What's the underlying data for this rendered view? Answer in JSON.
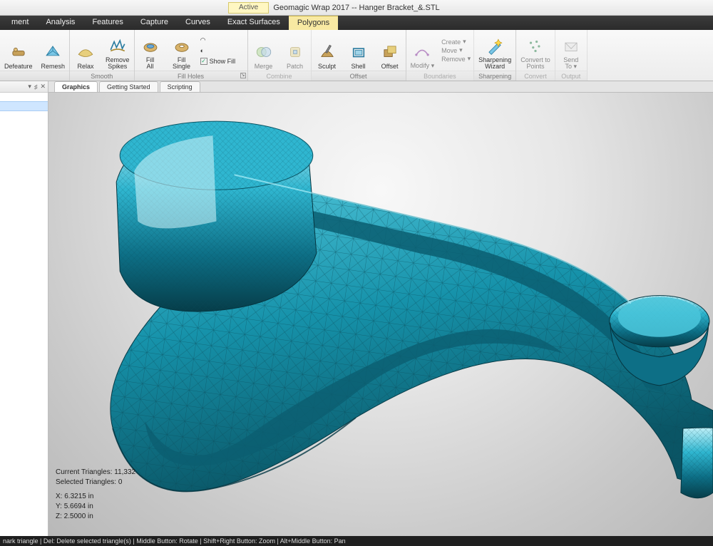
{
  "title": "Geomagic Wrap 2017 -- Hanger Bracket_&.STL",
  "active_badge": "Active",
  "menu": [
    "ment",
    "Analysis",
    "Features",
    "Capture",
    "Curves",
    "Exact Surfaces",
    "Polygons"
  ],
  "menu_active_index": 6,
  "ribbon": {
    "group0": {
      "label": "",
      "btns": [
        "Defeature",
        "Remesh"
      ]
    },
    "group1": {
      "label": "Smooth",
      "btns": [
        "Relax",
        "Remove Spikes"
      ]
    },
    "group2": {
      "label": "Fill Holes",
      "btns": [
        "Fill All",
        "Fill Single"
      ],
      "show_fill_check": "Show Fill"
    },
    "group3": {
      "label": "Combine",
      "btns": [
        "Merge",
        "Patch"
      ]
    },
    "group4": {
      "label": "Offset",
      "btns": [
        "Sculpt",
        "Shell",
        "Offset"
      ]
    },
    "group5": {
      "label": "Boundaries",
      "btn": "Modify",
      "lines": [
        "Create",
        "Move",
        "Remove"
      ]
    },
    "group6": {
      "label": "Sharpening",
      "btn": "Sharpening Wizard"
    },
    "group7": {
      "label": "Convert",
      "btn": "Convert to Points"
    },
    "group8": {
      "label": "Output",
      "btn": "Send To"
    }
  },
  "sidepane": {
    "pin": "▾ ♯ ✕"
  },
  "view_tabs": [
    "Graphics",
    "Getting Started",
    "Scripting"
  ],
  "view_tab_active": 0,
  "overlay": {
    "current_triangles_label": "Current Triangles:",
    "current_triangles_value": "11,332",
    "selected_triangles_label": "Selected Triangles:",
    "selected_triangles_value": "0",
    "x_label": "X:",
    "x_value": "6.3215 in",
    "y_label": "Y:",
    "y_value": "5.6694 in",
    "z_label": "Z:",
    "z_value": "2.5000 in"
  },
  "statusbar": "nark triangle | Del: Delete selected triangle(s) | Middle Button: Rotate | Shift+Right Button: Zoom | Alt+Middle Button: Pan",
  "colors": {
    "model": "#1a9cb8",
    "model_dark": "#0d5f72",
    "model_light": "#8fe0ee"
  }
}
